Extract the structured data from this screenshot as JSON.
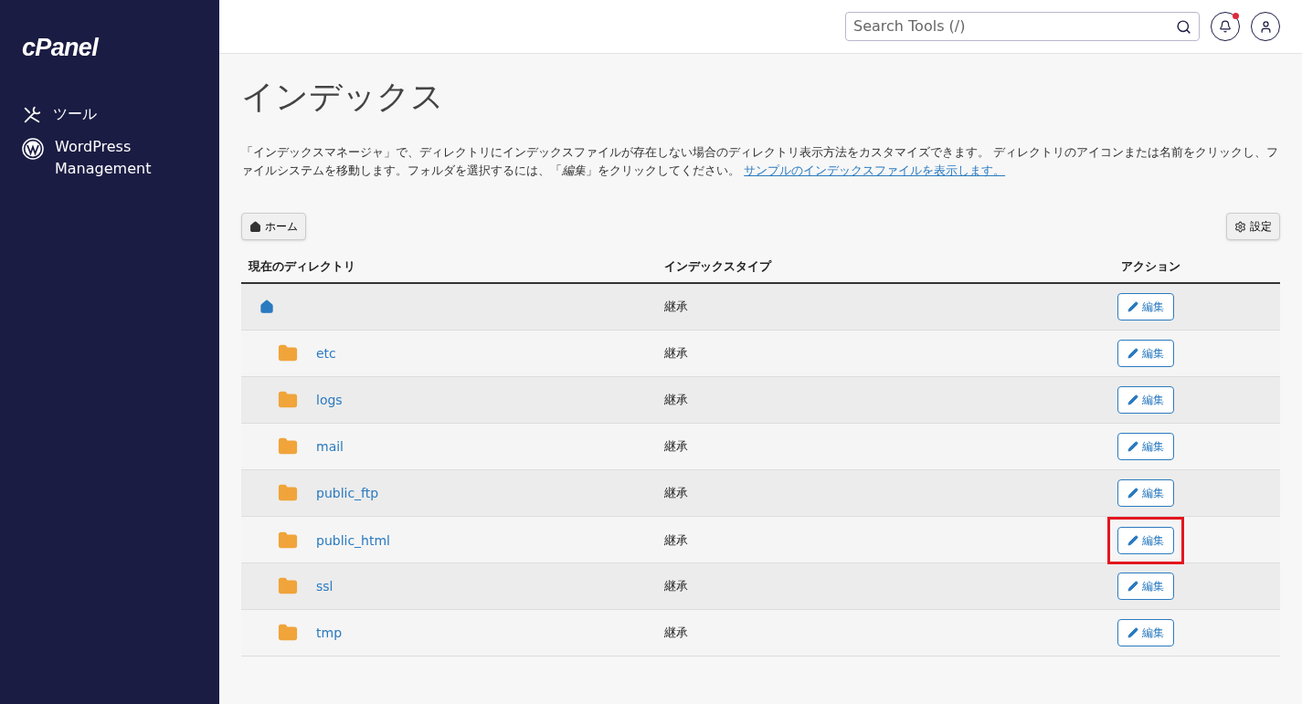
{
  "sidebar": {
    "logo": "cPanel",
    "items": [
      {
        "kind": "tools",
        "label": "ツール"
      },
      {
        "kind": "wordpress",
        "label": "WordPress Management"
      }
    ]
  },
  "header": {
    "search": {
      "placeholder": "Search Tools (/)"
    },
    "notification": true
  },
  "page": {
    "title": "インデックス",
    "description": "「インデックスマネージャ」で、ディレクトリにインデックスファイルが存在しない場合のディレクトリ表示方法をカスタマイズできます。 ディレクトリのアイコンまたは名前をクリックし、ファイルシステムを移動します。フォルダを選択するには、「*編集*」をクリックしてください。",
    "link": "サンプルのインデックスファイルを表示します。"
  },
  "toolbar": {
    "home_button": "ホーム",
    "settings_button": "設定"
  },
  "table": {
    "columns": [
      "現在のディレクトリ",
      "インデックスタイプ",
      "アクション"
    ],
    "rows": [
      {
        "kind": "home",
        "name": "",
        "type": "継承",
        "action": "編集",
        "highlighted": false
      },
      {
        "kind": "folder",
        "name": "etc",
        "type": "継承",
        "action": "編集",
        "highlighted": false
      },
      {
        "kind": "folder",
        "name": "logs",
        "type": "継承",
        "action": "編集",
        "highlighted": false
      },
      {
        "kind": "folder",
        "name": "mail",
        "type": "継承",
        "action": "編集",
        "highlighted": false
      },
      {
        "kind": "folder",
        "name": "public_ftp",
        "type": "継承",
        "action": "編集",
        "highlighted": false
      },
      {
        "kind": "folder",
        "name": "public_html",
        "type": "継承",
        "action": "編集",
        "highlighted": true
      },
      {
        "kind": "folder",
        "name": "ssl",
        "type": "継承",
        "action": "編集",
        "highlighted": false
      },
      {
        "kind": "folder",
        "name": "tmp",
        "type": "継承",
        "action": "編集",
        "highlighted": false
      }
    ]
  }
}
